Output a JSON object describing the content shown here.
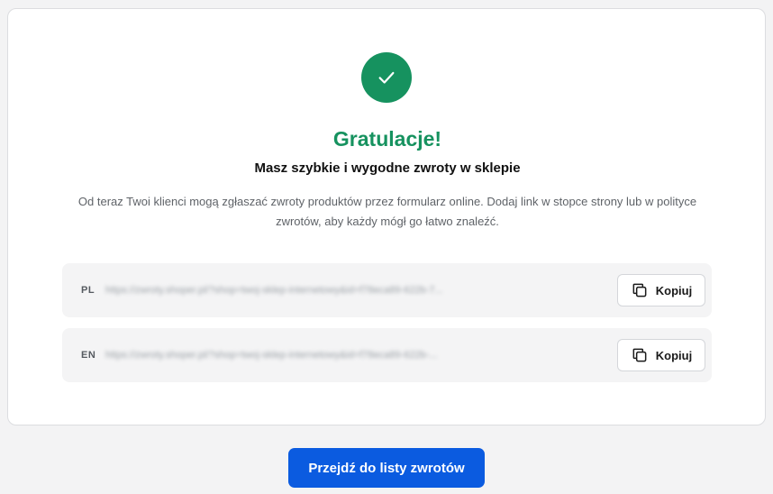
{
  "success": {
    "icon": "check-icon",
    "color": "#16925f",
    "title": "Gratulacje!",
    "subtitle": "Masz szybkie i wygodne zwroty w sklepie",
    "description": "Od teraz Twoi klienci mogą zgłaszać zwroty produktów przez formularz online. Dodaj link w stopce strony lub w polityce zwrotów, aby każdy mógł go łatwo znaleźć."
  },
  "links": [
    {
      "lang": "PL",
      "url": "https://zwroty.shoper.pl/?shop=twoj-sklep-internetowy&id=f78eca89-622b-7...",
      "copy_label": "Kopiuj",
      "copy_icon": "copy-icon"
    },
    {
      "lang": "EN",
      "url": "https://zwroty.shoper.pl/?shop=twoj-sklep-internetowy&id=f78eca89-622b-...",
      "copy_label": "Kopiuj",
      "copy_icon": "copy-icon"
    }
  ],
  "footer": {
    "primary_button_label": "Przejdź do listy zwrotów",
    "primary_color": "#0b5be0"
  }
}
